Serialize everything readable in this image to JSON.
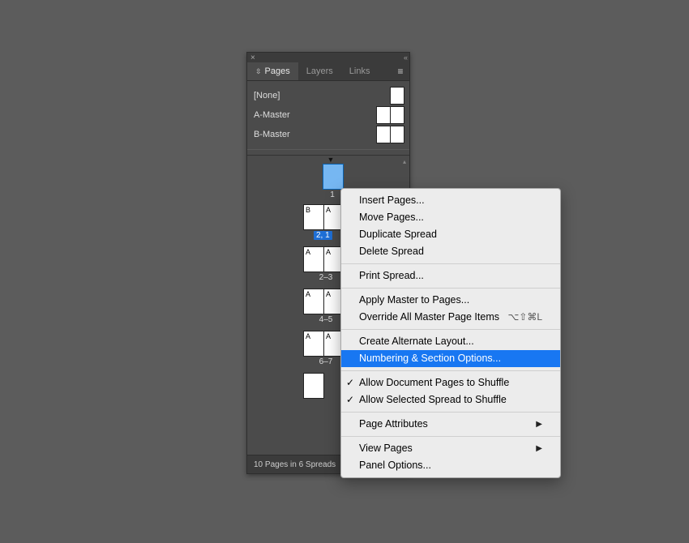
{
  "panel": {
    "close_glyph": "×",
    "collapse_glyph": "«",
    "menu_glyph": "≡",
    "tabs": [
      {
        "label": "Pages",
        "active": true,
        "updown": "⇳"
      },
      {
        "label": "Layers",
        "active": false
      },
      {
        "label": "Links",
        "active": false
      }
    ],
    "masters": [
      {
        "label": "[None]",
        "pages": 1
      },
      {
        "label": "A-Master",
        "pages": 2
      },
      {
        "label": "B-Master",
        "pages": 2
      }
    ],
    "section_marker_glyph": "▼",
    "spreads": [
      {
        "pages": [
          "1"
        ],
        "prefixes": [
          ""
        ],
        "selected": true,
        "num_label": "1",
        "label_sel": false
      },
      {
        "pages": [
          "2",
          "1"
        ],
        "prefixes": [
          "B",
          "A"
        ],
        "selected": false,
        "num_label": "2, 1",
        "label_sel": true
      },
      {
        "pages": [
          "2",
          "3"
        ],
        "prefixes": [
          "A",
          "A"
        ],
        "selected": false,
        "num_label": "2–3",
        "label_sel": false
      },
      {
        "pages": [
          "4",
          "5"
        ],
        "prefixes": [
          "A",
          "A"
        ],
        "selected": false,
        "num_label": "4–5",
        "label_sel": false
      },
      {
        "pages": [
          "6",
          "7"
        ],
        "prefixes": [
          "A",
          "A"
        ],
        "selected": false,
        "num_label": "6–7",
        "label_sel": false
      },
      {
        "pages": [
          ""
        ],
        "prefixes": [
          ""
        ],
        "selected": false,
        "num_label": "",
        "label_sel": false
      }
    ],
    "status_text": "10 Pages in 6 Spreads",
    "footer_icons": {
      "edit_glyph": "⬓",
      "new_glyph": "🗏",
      "trash_glyph": "🗑"
    }
  },
  "context_menu": {
    "items": [
      {
        "label": "Insert Pages...",
        "type": "item"
      },
      {
        "label": "Move Pages...",
        "type": "item"
      },
      {
        "label": "Duplicate Spread",
        "type": "item"
      },
      {
        "label": "Delete Spread",
        "type": "item"
      },
      {
        "type": "sep"
      },
      {
        "label": "Print Spread...",
        "type": "item"
      },
      {
        "type": "sep"
      },
      {
        "label": "Apply Master to Pages...",
        "type": "item"
      },
      {
        "label": "Override All Master Page Items",
        "type": "item",
        "shortcut": "⌥⇧⌘L"
      },
      {
        "type": "sep"
      },
      {
        "label": "Create Alternate Layout...",
        "type": "item"
      },
      {
        "label": "Numbering & Section Options...",
        "type": "item",
        "highlight": true
      },
      {
        "type": "sep"
      },
      {
        "label": "Allow Document Pages to Shuffle",
        "type": "item",
        "checked": true
      },
      {
        "label": "Allow Selected Spread to Shuffle",
        "type": "item",
        "checked": true
      },
      {
        "type": "sep"
      },
      {
        "label": "Page Attributes",
        "type": "submenu"
      },
      {
        "type": "sep"
      },
      {
        "label": "View Pages",
        "type": "submenu"
      },
      {
        "label": "Panel Options...",
        "type": "item"
      }
    ],
    "check_glyph": "✓",
    "submenu_glyph": "▶"
  }
}
